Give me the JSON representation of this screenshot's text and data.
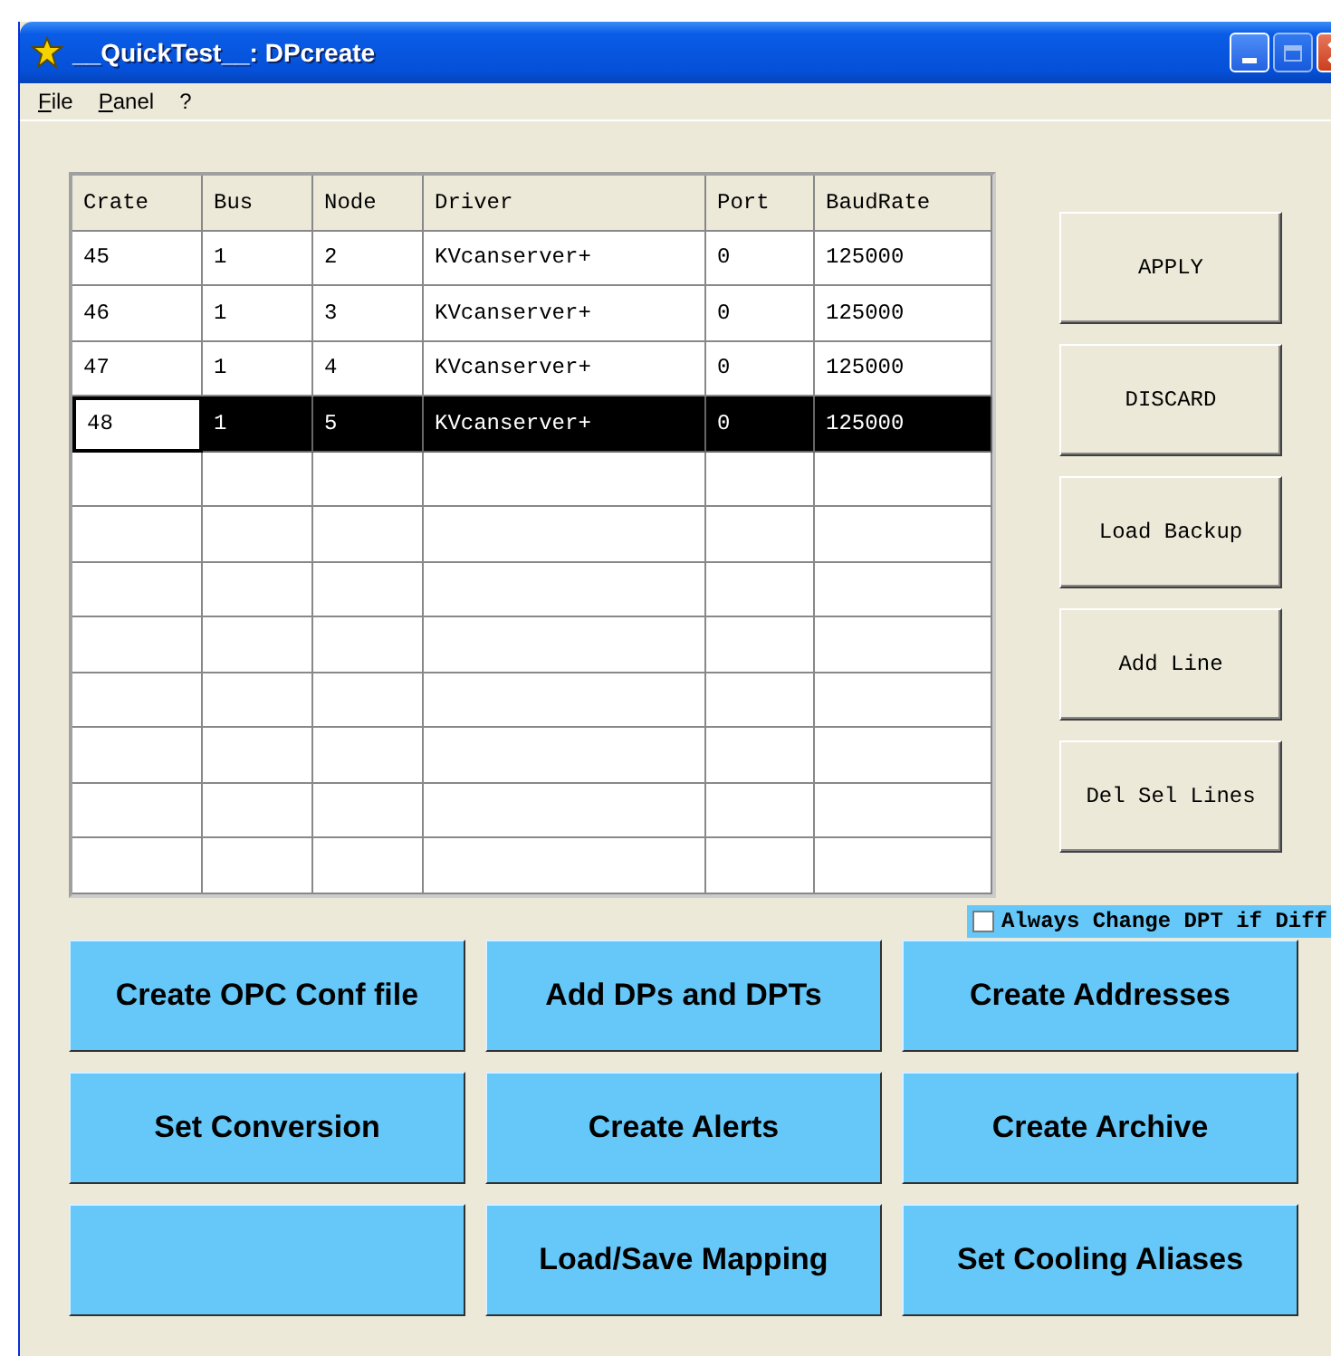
{
  "window": {
    "title": "__QuickTest__: DPcreate"
  },
  "menu": [
    {
      "label": "File"
    },
    {
      "label": "Panel"
    },
    {
      "label": "?"
    }
  ],
  "table": {
    "columns": [
      "Crate",
      "Bus",
      "Node",
      "Driver",
      "Port",
      "BaudRate"
    ],
    "rows": [
      {
        "cells": [
          "45",
          "1",
          "2",
          "KVcanserver+",
          "0",
          "125000"
        ],
        "selected": false
      },
      {
        "cells": [
          "46",
          "1",
          "3",
          "KVcanserver+",
          "0",
          "125000"
        ],
        "selected": false
      },
      {
        "cells": [
          "47",
          "1",
          "4",
          "KVcanserver+",
          "0",
          "125000"
        ],
        "selected": false
      },
      {
        "cells": [
          "48",
          "1",
          "5",
          "KVcanserver+",
          "0",
          "125000"
        ],
        "selected": true
      }
    ]
  },
  "side_buttons": [
    "APPLY",
    "DISCARD",
    "Load Backup",
    "Add Line",
    "Del Sel Lines"
  ],
  "option": {
    "label": "Always Change DPT if Diff",
    "checked": false
  },
  "action_buttons": [
    {
      "kind": "action",
      "label": "Create OPC Conf file"
    },
    {
      "kind": "action",
      "label": "Add DPs and DPTs"
    },
    {
      "kind": "action",
      "label": "Create Addresses"
    },
    {
      "kind": "action",
      "label": "Set Conversion"
    },
    {
      "kind": "action",
      "label": "Create Alerts"
    },
    {
      "kind": "action",
      "label": "Create Archive"
    },
    {
      "kind": "blank"
    },
    {
      "kind": "action",
      "label": "Load/Save Mapping"
    },
    {
      "kind": "action",
      "label": "Set Cooling Aliases"
    }
  ]
}
